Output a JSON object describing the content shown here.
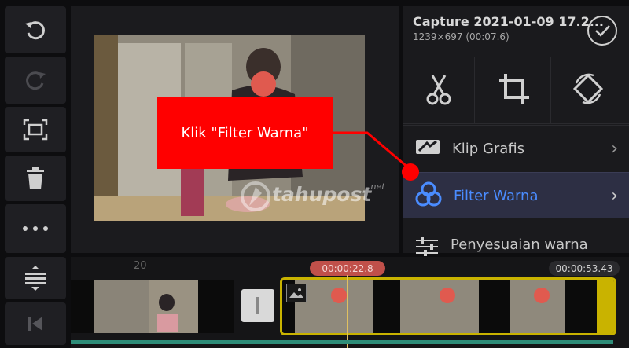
{
  "clip": {
    "title": "Capture 2021-01-09 17.2...",
    "info": "1239×697 (00:07.6)"
  },
  "tools": [
    "scissors-icon",
    "crop-icon",
    "rotate-icon"
  ],
  "menu": [
    {
      "label": "Klip Grafis",
      "icon": "clip-graphic-icon"
    },
    {
      "label": "Filter Warna",
      "icon": "color-filter-icon",
      "selected": true
    },
    {
      "label": "Penyesuaian warna",
      "icon": "sliders-icon"
    }
  ],
  "annotation": {
    "text": "Klik \"Filter Warna\""
  },
  "watermark": {
    "brand": "tahupost",
    "suffix": ".net"
  },
  "timeline": {
    "ruler_label": "20",
    "playhead_time": "00:00:22.8",
    "duration": "00:00:53.43"
  },
  "colors": {
    "accent_blue": "#4a8cff",
    "callout_red": "#ff0000",
    "timecode_red": "#c0504a",
    "clip_border": "#c9b300"
  }
}
